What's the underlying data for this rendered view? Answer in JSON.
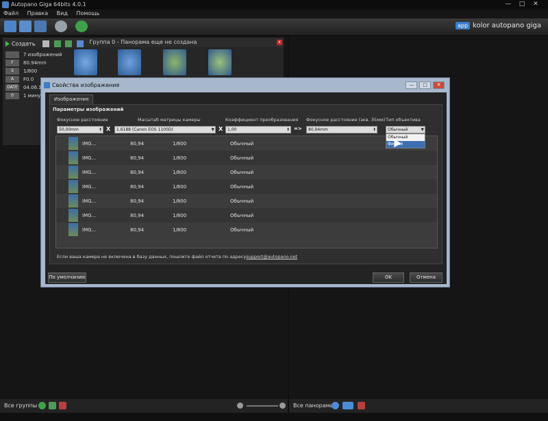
{
  "window": {
    "title": "Autopano Giga 64bits 4.0.1",
    "min": "—",
    "max": "□",
    "close": "✕"
  },
  "menu": [
    "Файл",
    "Правка",
    "Вид",
    "Помощь"
  ],
  "brand": {
    "logo": "app",
    "text": "kolor autopano giga"
  },
  "group": {
    "header": "Группа 0 - Панорама еще не создана",
    "close": "x",
    "create_label": "Создать"
  },
  "group_info": [
    {
      "key": "",
      "value": "7 изображений"
    },
    {
      "key": "F",
      "value": "80.94mm"
    },
    {
      "key": "S",
      "value": "1/800"
    },
    {
      "key": "A",
      "value": "F0.0"
    },
    {
      "key": "DATE",
      "value": "04.06.1"
    },
    {
      "key": "⏱",
      "value": "1 минут"
    }
  ],
  "dialog": {
    "title": "Свойства изображения",
    "tab": "Изображения",
    "section": "Параметры изображений",
    "labels": {
      "focal": "Фокусное расстояние",
      "sensor": "Масштаб матрицы камеры",
      "coef": "Коэффициент преобразования",
      "focal35": "Фокусное расстояние (экв. 35мм)",
      "lens": "Тип объектива"
    },
    "fields": {
      "focal": "50,00mm",
      "sensor": "1.6188 (Canon EOS 1100D)",
      "coef": "1,00",
      "focal35": "80,94mm",
      "lens": "Обычный"
    },
    "ops": {
      "x1": "X",
      "x2": "X",
      "arrow": "=>"
    },
    "lens_options": [
      "Обычный",
      "Фишай"
    ],
    "rows": [
      {
        "name": "IMG...",
        "focal": "80,94",
        "shutter": "1/800",
        "lens": "Обычный"
      },
      {
        "name": "IMG...",
        "focal": "80,94",
        "shutter": "1/800",
        "lens": "Обычный"
      },
      {
        "name": "IMG...",
        "focal": "80,94",
        "shutter": "1/800",
        "lens": "Обычный"
      },
      {
        "name": "IMG...",
        "focal": "80,94",
        "shutter": "1/800",
        "lens": "Обычный"
      },
      {
        "name": "IMG...",
        "focal": "80,94",
        "shutter": "1/800",
        "lens": "Обычный"
      },
      {
        "name": "IMG...",
        "focal": "80,94",
        "shutter": "1/800",
        "lens": "Обычный"
      },
      {
        "name": "IMG...",
        "focal": "80,94",
        "shutter": "1/800",
        "lens": "Обычный"
      }
    ],
    "note": "Если ваша камера не включена в базу данных, пошлите файл отчета по адресу",
    "note_email": "support@autopano.net",
    "default_btn": "По умолчанию",
    "ok_btn": "OK",
    "cancel_btn": "Отмена"
  },
  "bottom": {
    "groups": "Все группы",
    "panoramas": "Все панорамы"
  },
  "colors": {
    "accent": "#3b7dc6",
    "close_red": "#c72424",
    "dialog_frame": "#a8b8cc"
  }
}
